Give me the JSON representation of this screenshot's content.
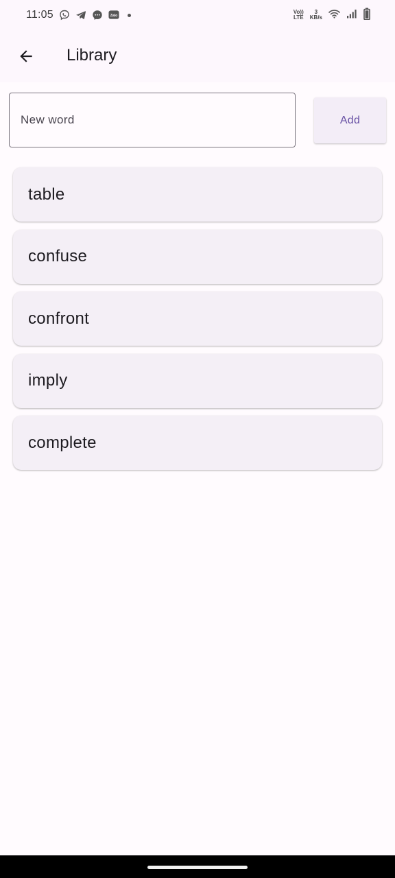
{
  "status_bar": {
    "time": "11:05",
    "notification_icons": [
      "viber-icon",
      "telegram-icon",
      "messenger-icon",
      "zalo-icon"
    ],
    "zalo_label": "Zalo",
    "volte_line1": "Vo))",
    "volte_line2": "LTE",
    "speed_value": "3",
    "speed_unit": "KB/s",
    "system_icons": [
      "wifi-icon",
      "signal-icon",
      "battery-icon"
    ]
  },
  "app_bar": {
    "title": "Library",
    "back_icon": "arrow-back-icon"
  },
  "add_form": {
    "input_placeholder": "New word",
    "input_value": "",
    "add_label": "Add"
  },
  "words": [
    {
      "text": "table"
    },
    {
      "text": "confuse"
    },
    {
      "text": "confront"
    },
    {
      "text": "imply"
    },
    {
      "text": "complete"
    }
  ],
  "colors": {
    "background": "#fffbfe",
    "surface": "#fdf7fd",
    "card": "#f4eff6",
    "primary": "#6750a4",
    "outline": "#79747e",
    "text": "#1d1b20"
  }
}
